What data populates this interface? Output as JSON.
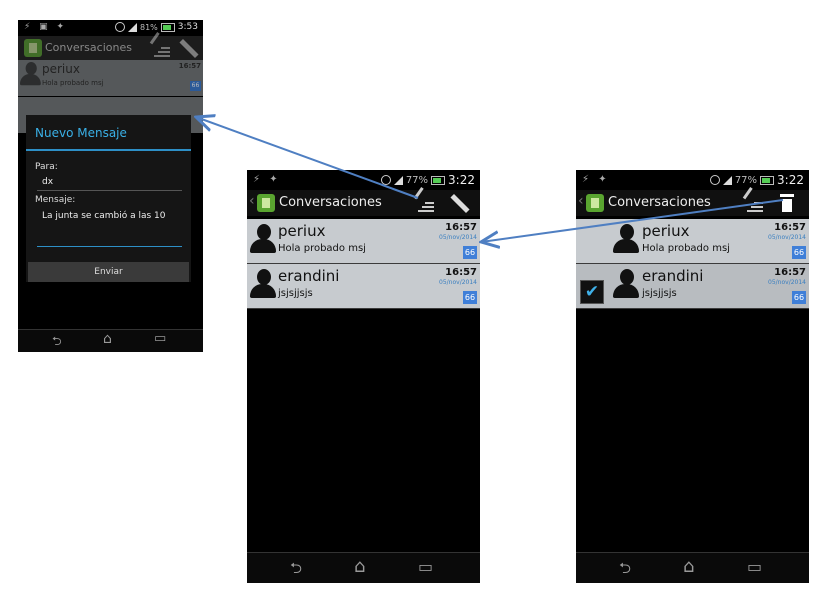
{
  "phone1": {
    "status": {
      "left_icons": "⚡ ▣ ✦",
      "battery": "81%",
      "time": "3:53"
    },
    "actionbar": {
      "title": "Conversaciones"
    },
    "conversation": {
      "name": "periux",
      "message": "Hola probado msj",
      "time": "16:57",
      "badge": "66"
    },
    "dialog": {
      "title": "Nuevo Mensaje",
      "to_label": "Para:",
      "to_value": "dx",
      "message_label": "Mensaje:",
      "message_value": "La junta se cambió a las 10",
      "send_label": "Enviar"
    },
    "nav": {
      "back": "⮌",
      "home": "⌂",
      "recent": "▭"
    }
  },
  "phone2": {
    "status": {
      "left_icons": "⚡ ✦",
      "battery": "77%",
      "time": "3:22"
    },
    "actionbar": {
      "back": "‹",
      "title": "Conversaciones"
    },
    "conversations": [
      {
        "name": "periux",
        "message": "Hola probado msj",
        "time": "16:57",
        "date": "05/nov/2014",
        "badge": "66"
      },
      {
        "name": "erandini",
        "message": "jsjsjjsjs",
        "time": "16:57",
        "date": "05/nov/2014",
        "badge": "66"
      }
    ],
    "nav": {
      "back": "⮌",
      "home": "⌂",
      "recent": "▭"
    }
  },
  "phone3": {
    "status": {
      "left_icons": "⚡ ✦",
      "battery": "77%",
      "time": "3:22"
    },
    "actionbar": {
      "back": "‹",
      "title": "Conversaciones"
    },
    "conversations": [
      {
        "name": "periux",
        "message": "Hola probado msj",
        "time": "16:57",
        "date": "05/nov/2014",
        "badge": "66"
      },
      {
        "name": "erandini",
        "message": "jsjsjjsjs",
        "time": "16:57",
        "date": "05/nov/2014",
        "badge": "66",
        "checkmark": "✔"
      }
    ],
    "nav": {
      "back": "⮌",
      "home": "⌂",
      "recent": "▭"
    }
  },
  "colors": {
    "accent": "#3ab0e6",
    "badge": "#3f7fd8",
    "row": "#c7cbcf",
    "arrow": "#4f7fc2"
  }
}
